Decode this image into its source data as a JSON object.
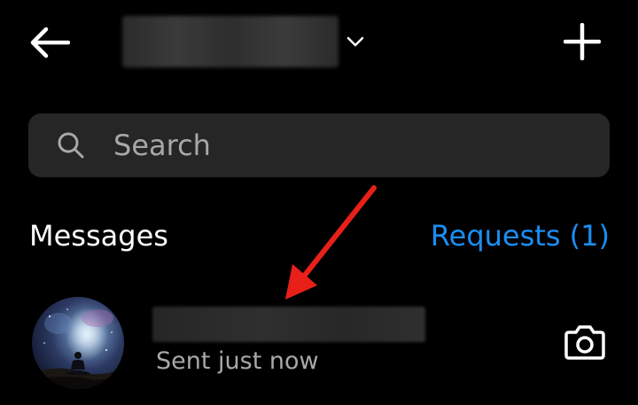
{
  "header": {
    "back_icon": "arrow-left-icon",
    "account_name": "",
    "chevron_icon": "chevron-down-icon",
    "new_message_icon": "plus-icon"
  },
  "search": {
    "placeholder": "Search",
    "value": "",
    "icon": "search-icon"
  },
  "section": {
    "title": "Messages",
    "requests_label": "Requests (1)"
  },
  "conversations": [
    {
      "name": "",
      "status": "Sent just now",
      "action_icon": "camera-icon"
    }
  ],
  "colors": {
    "background": "#000000",
    "search_bg": "#262626",
    "link": "#1a8ef4",
    "secondary_text": "#a8a8a8",
    "annotation": "#e8201a"
  }
}
